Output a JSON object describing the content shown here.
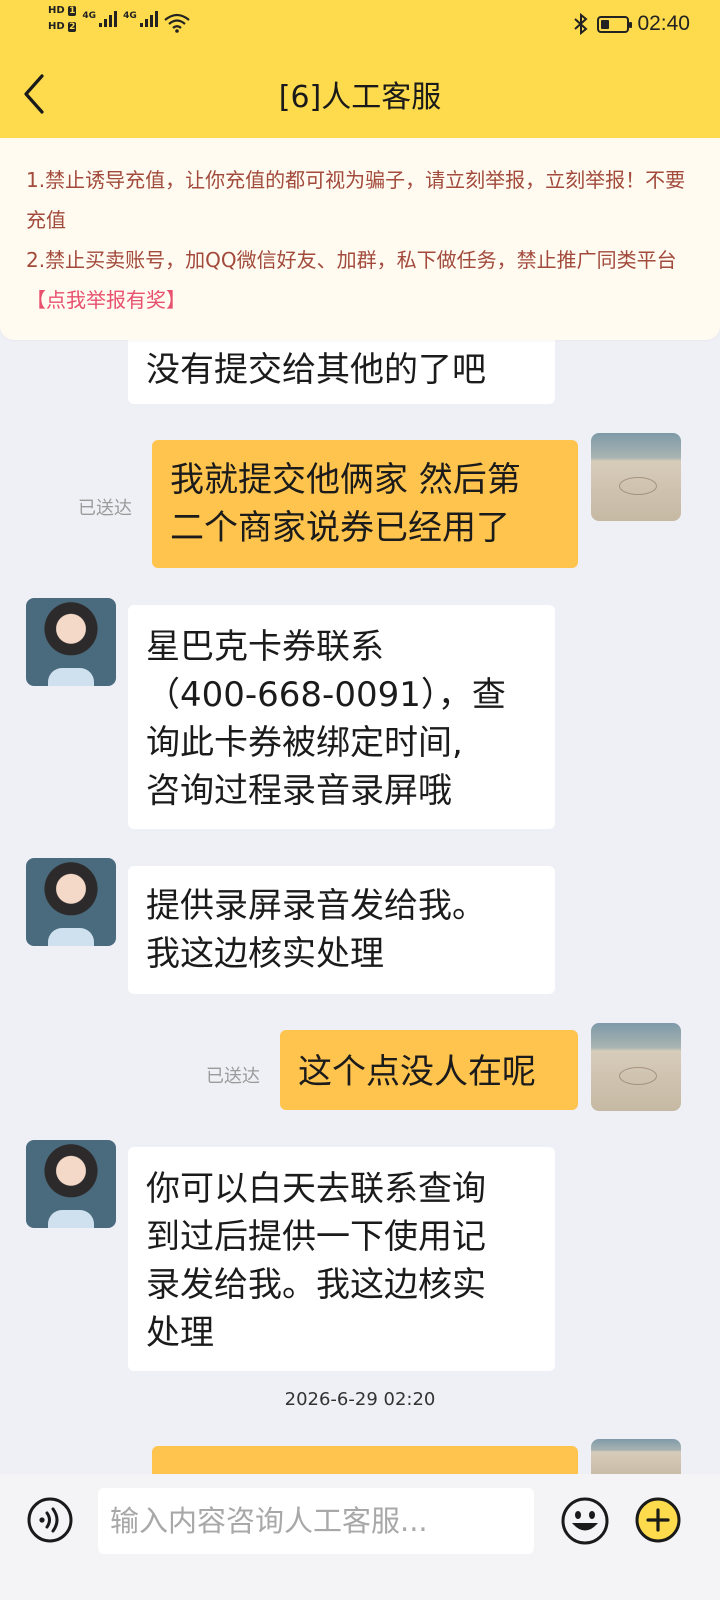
{
  "status_bar": {
    "hd_1": "HD",
    "sim_1": "1",
    "hd_2": "HD",
    "sim_2": "2",
    "network_1": "4G",
    "network_2": "4G",
    "time": "02:40",
    "battery_level": 0.35
  },
  "header": {
    "title": "[6]人工客服"
  },
  "notice": {
    "line_1": "1.禁止诱导充值，让你充值的都可视为骗子，请立刻举报，立刻举报！不要充值",
    "line_2_prefix": "2.禁止买卖账号，加QQ微信好友、加群，私下做任务，禁止推广同类平台",
    "report_link": "【点我举报有奖】"
  },
  "messages": [
    {
      "from": "agent",
      "text": "没有提交给其他的了吧"
    },
    {
      "from": "user",
      "status": "已送达",
      "lines": [
        "我就提交他俩家 然后第",
        "二个商家说券已经用了"
      ]
    },
    {
      "from": "agent",
      "lines": [
        "星巴克卡券联系",
        "（400-668-0091），查",
        "询此卡券被绑定时间,",
        "咨询过程录音录屏哦"
      ]
    },
    {
      "from": "agent",
      "lines": [
        "提供录屏录音发给我。",
        "我这边核实处理"
      ]
    },
    {
      "from": "user",
      "status": "已送达",
      "text": "这个点没人在呢"
    },
    {
      "from": "agent",
      "lines": [
        "你可以白天去联系查询",
        "到过后提供一下使用记",
        "录发给我。我这边核实",
        "处理"
      ]
    }
  ],
  "timestamp": "2026-6-29 02:20",
  "input": {
    "placeholder": "输入内容咨询人工客服..."
  },
  "icons": {
    "back": "chevron-left-icon",
    "voice": "voice-icon",
    "emoji": "smiley-icon",
    "more": "plus-icon"
  },
  "colors": {
    "header_bg": "#fddb4d",
    "user_bubble": "#ffc44e",
    "notice_text": "#a24a3c",
    "report_link": "#e8506e"
  }
}
